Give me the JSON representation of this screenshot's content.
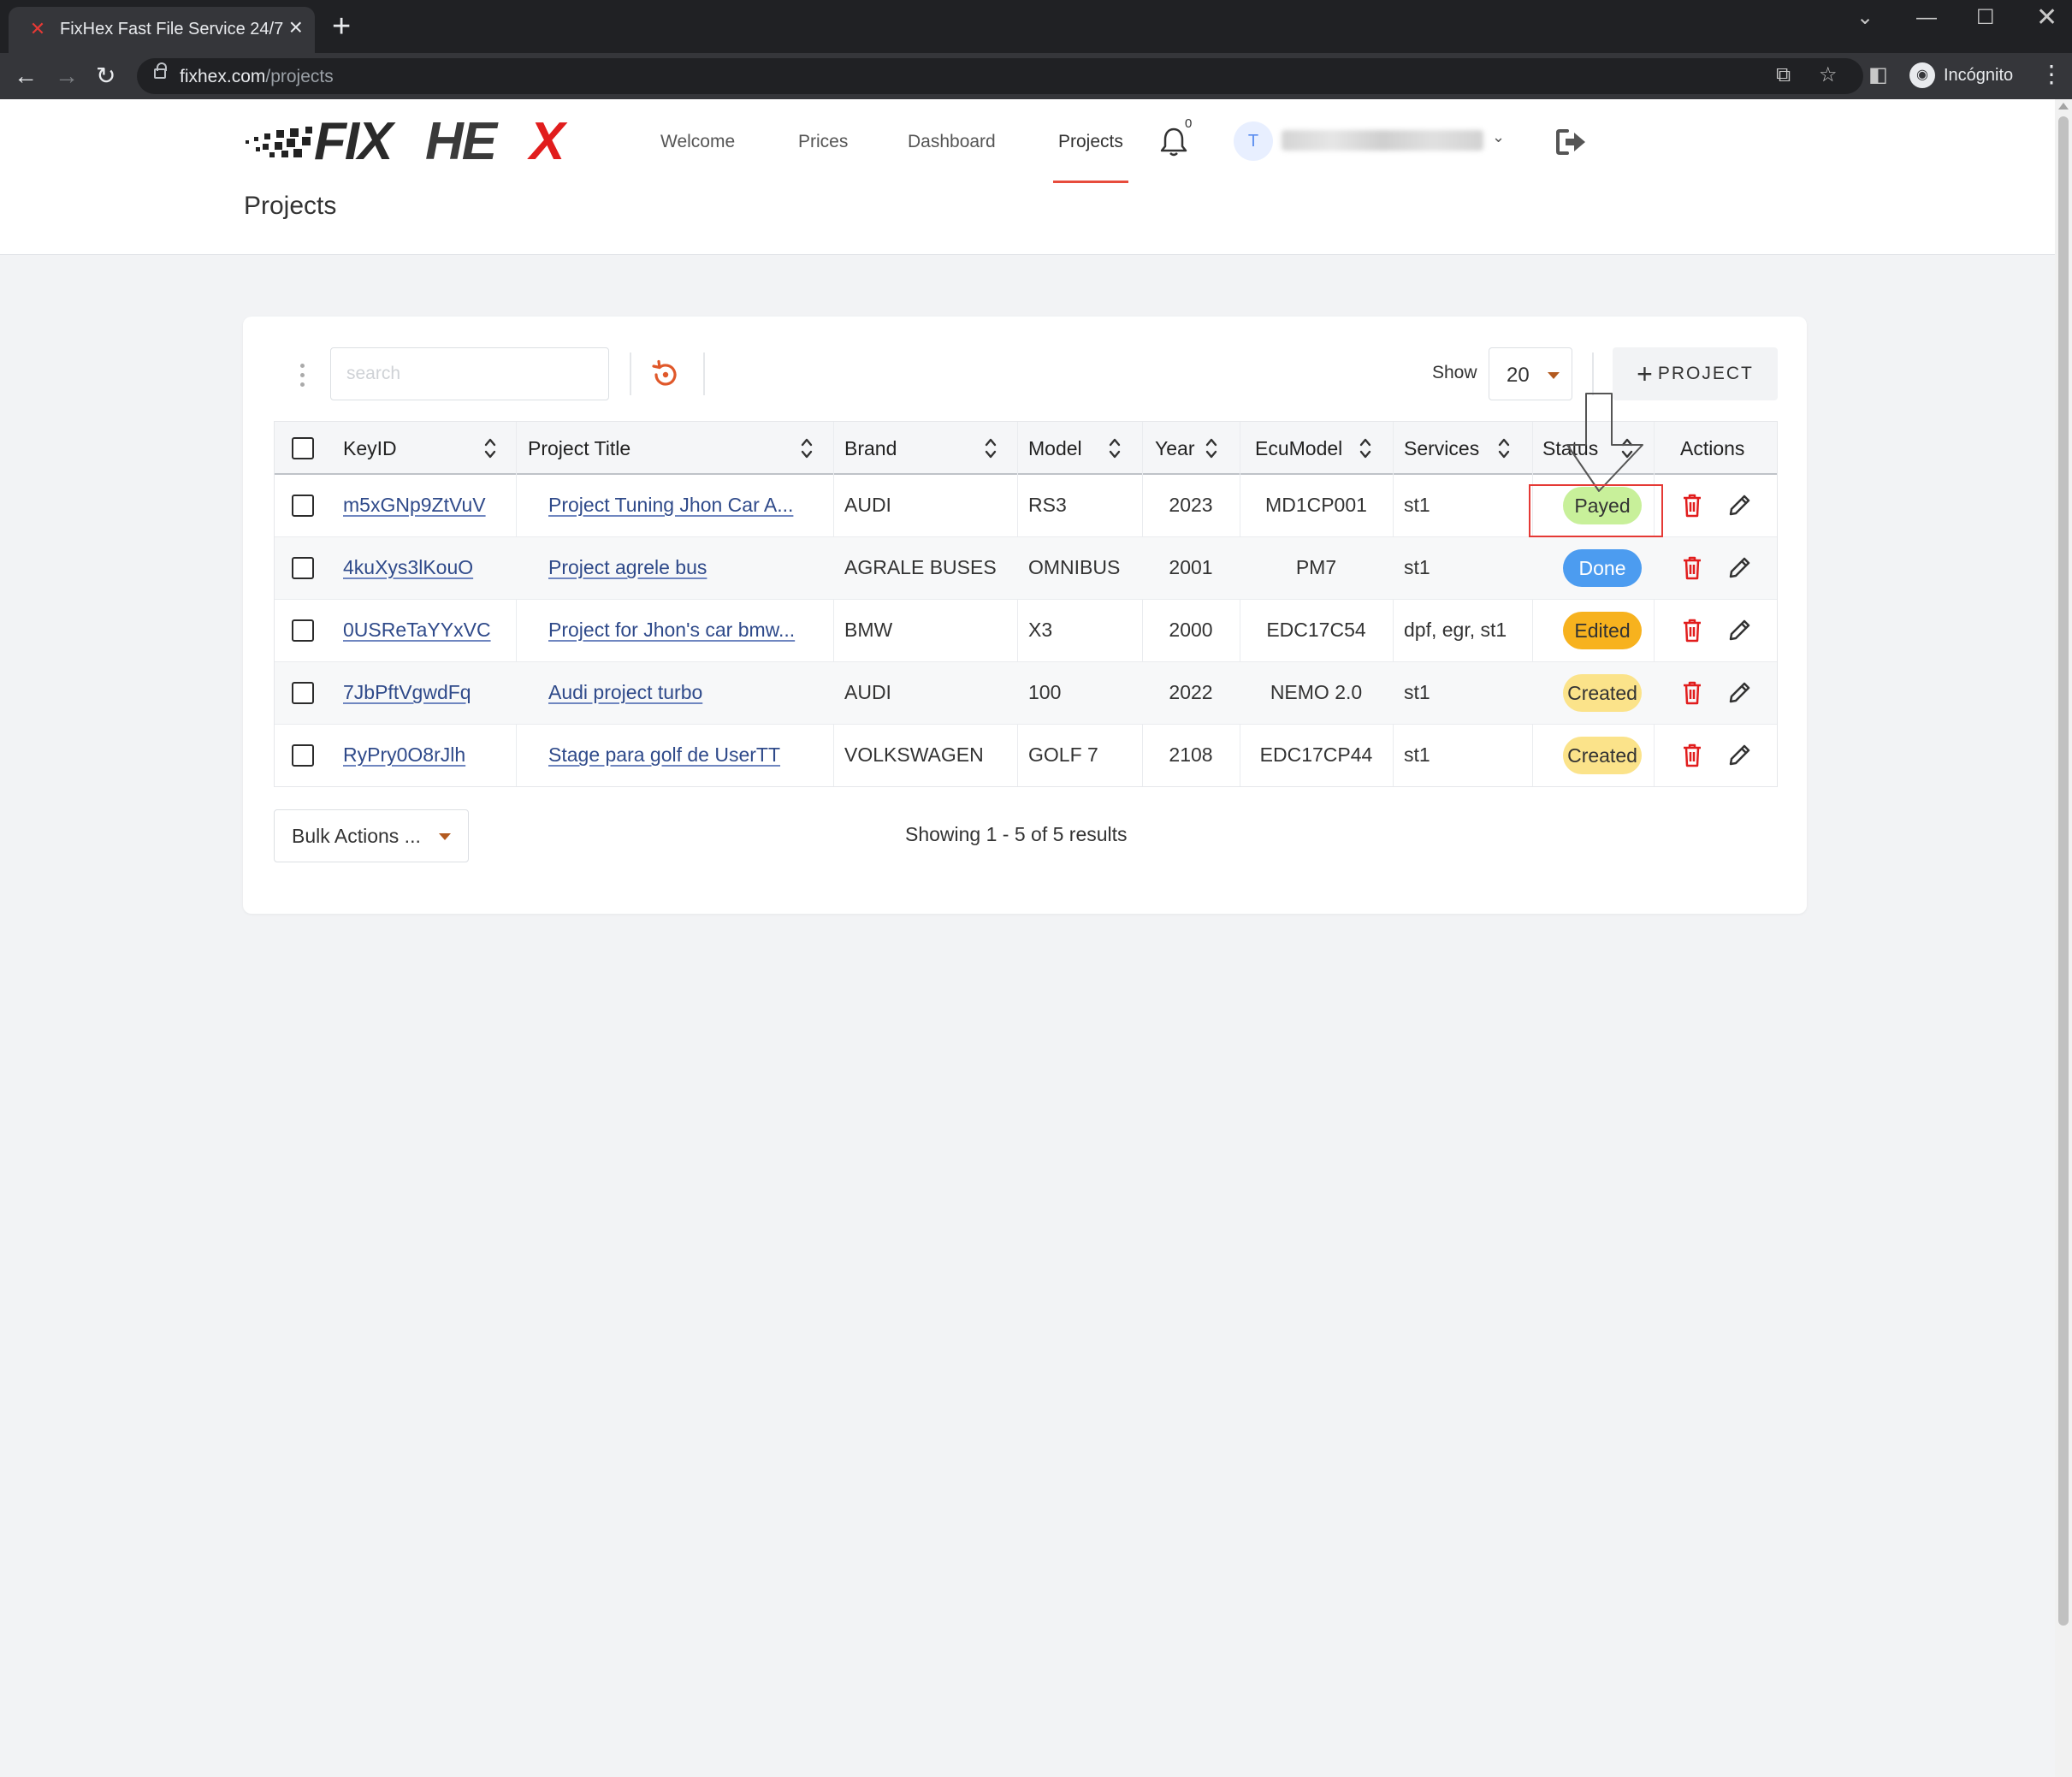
{
  "browser": {
    "tab_title": "FixHex Fast File Service 24/7",
    "url_domain": "fixhex.com",
    "url_path": "/projects",
    "profile_label": "Incógnito"
  },
  "header": {
    "logo_text": "FIXHEX",
    "nav": [
      "Welcome",
      "Prices",
      "Dashboard",
      "Projects"
    ],
    "active_nav": "Projects",
    "notification_count": "0",
    "avatar_initial": "T",
    "page_title": "Projects"
  },
  "toolbar": {
    "search_placeholder": "search",
    "show_label": "Show",
    "show_value": "20",
    "add_button_label": "PROJECT"
  },
  "table": {
    "columns": [
      "KeyID",
      "Project Title",
      "Brand",
      "Model",
      "Year",
      "EcuModel",
      "Services",
      "Status",
      "Actions"
    ],
    "rows": [
      {
        "key_id": "m5xGNp9ZtVuV",
        "title": "Project Tuning Jhon Car A...",
        "brand": "AUDI",
        "model": "RS3",
        "year": "2023",
        "ecu": "MD1CP001",
        "services": "st1",
        "status": "Payed",
        "status_color": "#c8f09a"
      },
      {
        "key_id": "4kuXys3lKouO",
        "title": "Project agrele bus",
        "brand": "AGRALE BUSES",
        "model": "OMNIBUS",
        "year": "2001",
        "ecu": "PM7",
        "services": "st1",
        "status": "Done",
        "status_color": "#4c9cf0"
      },
      {
        "key_id": "0USReTaYYxVC",
        "title": "Project for Jhon's car bmw...",
        "brand": "BMW",
        "model": "X3",
        "year": "2000",
        "ecu": "EDC17C54",
        "services": "dpf, egr, st1",
        "status": "Edited",
        "status_color": "#f7b21e"
      },
      {
        "key_id": "7JbPftVgwdFq",
        "title": "Audi project turbo",
        "brand": "AUDI",
        "model": "100",
        "year": "2022",
        "ecu": "NEMO 2.0",
        "services": "st1",
        "status": "Created",
        "status_color": "#fbe38a"
      },
      {
        "key_id": "RyPry0O8rJlh",
        "title": "Stage para golf de UserTT",
        "brand": "VOLKSWAGEN",
        "model": "GOLF 7",
        "year": "2108",
        "ecu": "EDC17CP44",
        "services": "st1",
        "status": "Created",
        "status_color": "#fbe38a"
      }
    ]
  },
  "footer": {
    "bulk_label": "Bulk Actions ...",
    "results_text": "Showing 1 - 5 of 5 results"
  },
  "colors": {
    "accent_red": "#e53935",
    "nav_underline": "#e74c3c",
    "refresh_icon": "#e0582a",
    "link": "#2f4a8a"
  },
  "icons": [
    "bell-icon",
    "refresh-icon",
    "trash-icon",
    "pencil-icon",
    "logout-icon",
    "sort-icon",
    "plus-icon"
  ]
}
